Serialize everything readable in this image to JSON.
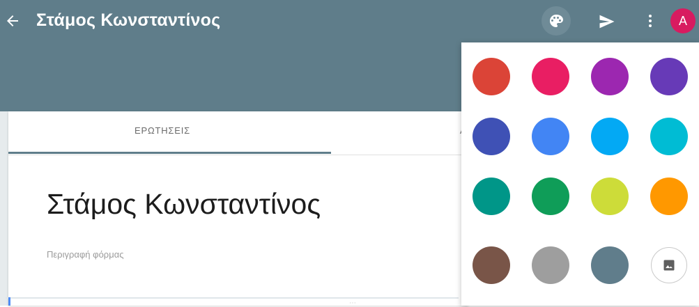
{
  "app": {
    "title": "Στάμος Κωνσταντίνος",
    "avatar_initial": "A",
    "icons": {
      "back": "arrow-back-icon",
      "palette": "palette-icon",
      "send": "send-icon",
      "more": "more-vert-icon",
      "image": "image-icon"
    }
  },
  "tabs": [
    {
      "label": "ΕΡΩΤΗΣΕΙΣ"
    },
    {
      "label": "Α"
    }
  ],
  "form": {
    "title": "Στάμος Κωνσταντίνος",
    "description_placeholder": "Περιγραφή φόρμας"
  },
  "colors": {
    "appbar": "#5f7d8a",
    "swatches": [
      "#db4437",
      "#e91e63",
      "#9c27b0",
      "#673ab7",
      "#3f51b5",
      "#4285f4",
      "#03a9f4",
      "#00bcd4",
      "#009688",
      "#0f9d58",
      "#cddc39",
      "#ff9800",
      "#795548",
      "#9e9e9e",
      "#607d8b"
    ]
  }
}
